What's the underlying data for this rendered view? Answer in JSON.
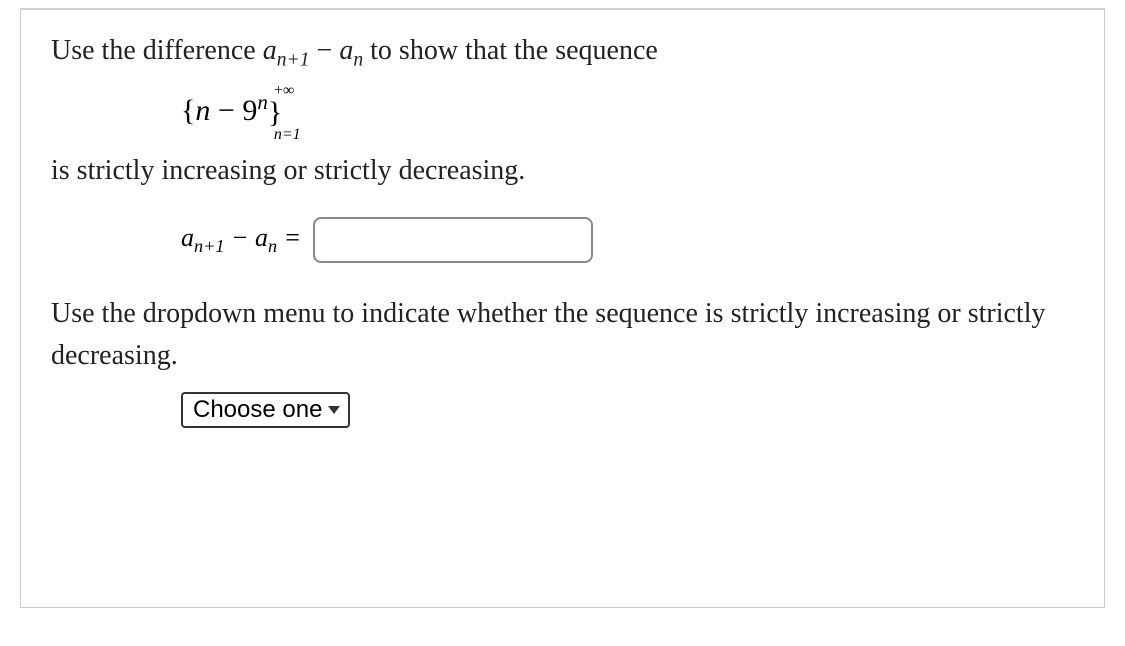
{
  "line1_part1": "Use the difference ",
  "line1_math_a": "a",
  "line1_math_sub1": "n+1",
  "line1_math_minus": " − ",
  "line1_math_sub2": "n",
  "line1_part2": " to show that the sequence",
  "formula": {
    "open_brace": "{",
    "n": "n",
    "minus": " − ",
    "nine": "9",
    "exp_n": "n",
    "close_brace": "}",
    "upper_limit": "+∞",
    "lower_limit": "n=1"
  },
  "line2": "is strictly increasing or strictly decreasing.",
  "answer": {
    "a1": "a",
    "sub1": "n+1",
    "minus": " − ",
    "a2": "a",
    "sub2": "n",
    "equals": " =",
    "value": ""
  },
  "line3": "Use the dropdown menu to indicate whether the sequence is strictly increasing or strictly decreasing.",
  "dropdown": {
    "selected": "Choose one"
  }
}
